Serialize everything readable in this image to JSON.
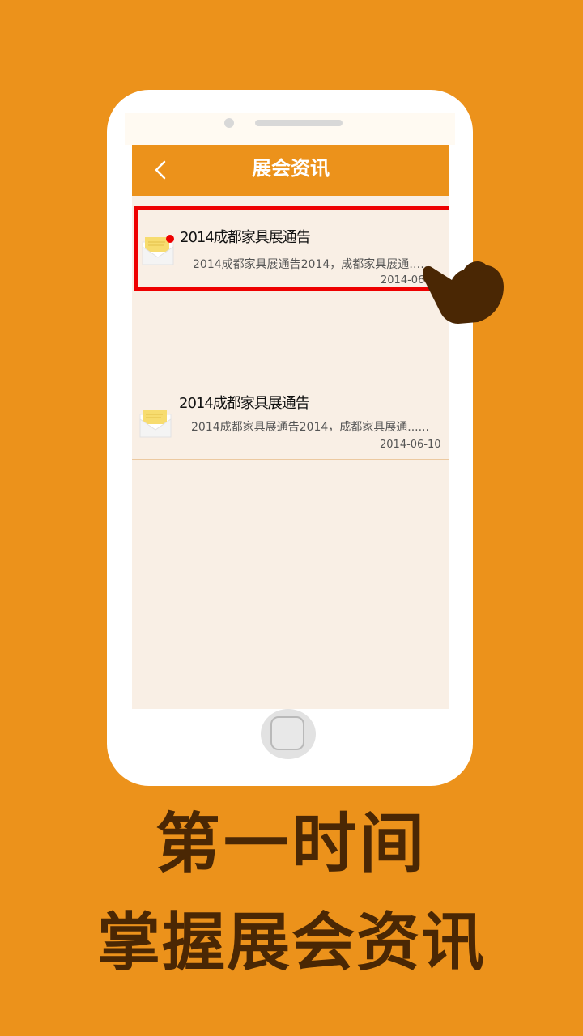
{
  "app": {
    "title": "展会资讯"
  },
  "news_items": [
    {
      "title": "2014成都家具展通告",
      "summary": "2014成都家具展通告2014，成都家具展通……",
      "date": "2014-06-1",
      "unread": true,
      "selected": true
    },
    {
      "title": "2014成都家具展通告",
      "summary": "2014成都家具展通告2014，成都家具展通......",
      "date": "2014-06-10",
      "unread": false,
      "selected": false
    }
  ],
  "captions": {
    "line1": "第一时间",
    "line2": "掌握展会资讯"
  },
  "colors": {
    "background": "#ec921b",
    "header": "#ec921b",
    "highlight_border": "#ee0000",
    "caption_text": "#4a2704",
    "hand": "#4a2704"
  },
  "icons": [
    "back-icon",
    "mail-icon",
    "home-button",
    "hand-pointer-icon"
  ]
}
